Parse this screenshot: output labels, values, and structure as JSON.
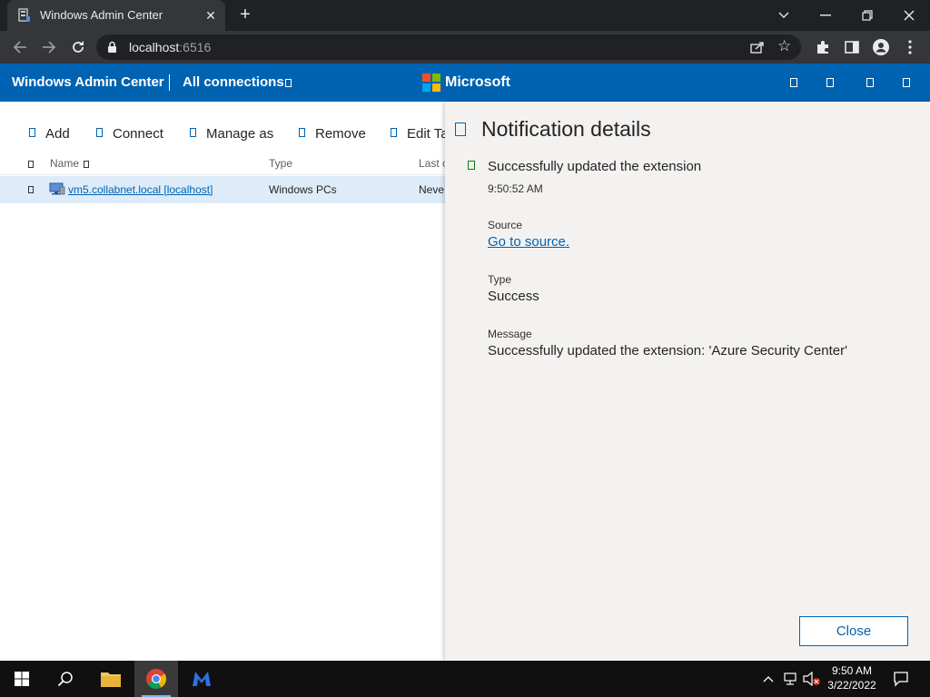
{
  "browser": {
    "tab_title": "Windows Admin Center",
    "tab_icon": "server-icon",
    "url_host": "localhost",
    "url_port": ":6516"
  },
  "header": {
    "app_title": "Windows Admin Center",
    "breadcrumb": "All connections",
    "brand": "Microsoft",
    "brand_colors": [
      "#f25022",
      "#7fba00",
      "#00a4ef",
      "#ffb900"
    ],
    "accent": "#0063b1"
  },
  "commands": {
    "add": "Add",
    "connect": "Connect",
    "manage_as": "Manage as",
    "remove": "Remove",
    "edit_tags": "Edit Ta"
  },
  "table": {
    "columns": [
      "Name",
      "Type",
      "Last c"
    ],
    "rows": [
      {
        "name": "vm5.collabnet.local [localhost]",
        "type": "Windows PCs",
        "last": "Neve"
      }
    ]
  },
  "notification": {
    "title": "Notification details",
    "message": "Successfully updated the extension",
    "time": "9:50:52 AM",
    "source_label": "Source",
    "source_link": "Go to source.",
    "type_label": "Type",
    "type_value": "Success",
    "message_label": "Message",
    "message_value": "Successfully updated the extension: 'Azure Security Center'",
    "close_label": "Close",
    "status_color": "#107c10"
  },
  "taskbar": {
    "time": "9:50 AM",
    "date": "3/22/2022"
  }
}
